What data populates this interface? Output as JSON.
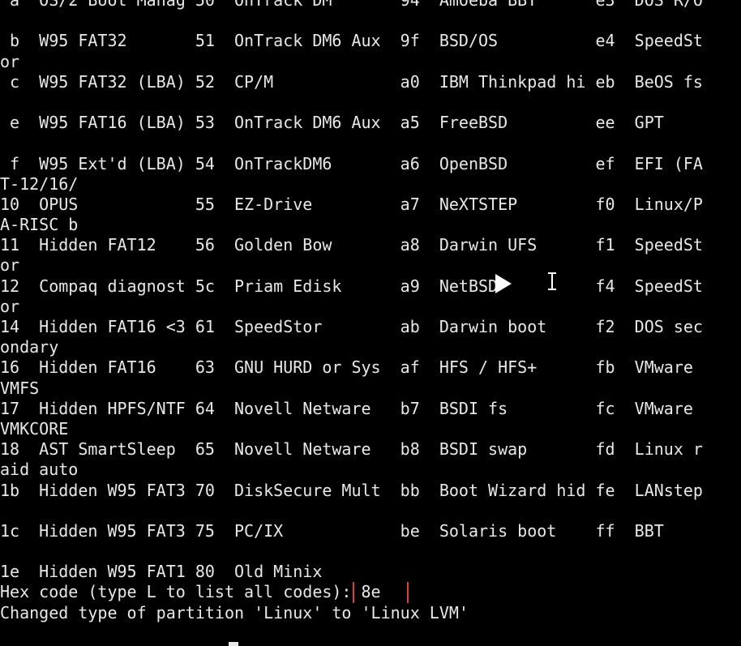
{
  "terminal": {
    "lines": [
      " a  OS/2 Boot Manag 50  OnTrack DM       94  Amoeba BBT      e3  DOS R/O",
      "",
      " b  W95 FAT32       51  OnTrack DM6 Aux  9f  BSD/OS          e4  SpeedSt",
      "or",
      " c  W95 FAT32 (LBA) 52  CP/M             a0  IBM Thinkpad hi eb  BeOS fs",
      "",
      " e  W95 FAT16 (LBA) 53  OnTrack DM6 Aux  a5  FreeBSD         ee  GPT",
      "",
      " f  W95 Ext'd (LBA) 54  OnTrackDM6       a6  OpenBSD         ef  EFI (FA",
      "T-12/16/",
      "10  OPUS            55  EZ-Drive         a7  NeXTSTEP        f0  Linux/P",
      "A-RISC b",
      "11  Hidden FAT12    56  Golden Bow       a8  Darwin UFS      f1  SpeedSt",
      "or",
      "12  Compaq diagnost 5c  Priam Edisk      a9  NetBSD          f4  SpeedSt",
      "or",
      "14  Hidden FAT16 <3 61  SpeedStor        ab  Darwin boot     f2  DOS sec",
      "ondary",
      "16  Hidden FAT16    63  GNU HURD or Sys  af  HFS / HFS+      fb  VMware",
      "VMFS",
      "17  Hidden HPFS/NTF 64  Novell Netware   b7  BSDI fs         fc  VMware",
      "VMKCORE",
      "18  AST SmartSleep  65  Novell Netware   b8  BSDI swap       fd  Linux r",
      "aid auto",
      "1b  Hidden W95 FAT3 70  DiskSecure Mult  bb  Boot Wizard hid fe  LANstep",
      "",
      "1c  Hidden W95 FAT3 75  PC/IX            be  Solaris boot    ff  BBT",
      "",
      "1e  Hidden W95 FAT1 80  Old Minix"
    ],
    "prompt_label": "Hex code (type L to list all codes):",
    "input_value": "8e",
    "result_message": "Changed type of partition 'Linux' to 'Linux LVM'"
  },
  "colors": {
    "background": "#000000",
    "text": "#e8e8e8",
    "highlight_box": "#d94040"
  },
  "icons": [
    "play-icon",
    "ibeam-cursor-icon",
    "terminal-cursor"
  ]
}
